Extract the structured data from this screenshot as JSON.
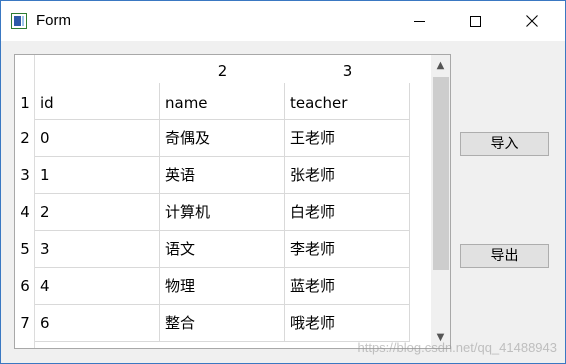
{
  "window": {
    "title": "Form",
    "controls": {
      "minimize": "minimize",
      "maximize": "maximize",
      "close": "✕"
    }
  },
  "table": {
    "column_headers": [
      "",
      "2",
      "3"
    ],
    "row_headers": [
      "1",
      "2",
      "3",
      "4",
      "5",
      "6",
      "7"
    ],
    "rows": [
      [
        "id",
        "name",
        "teacher"
      ],
      [
        "0",
        "奇偶及",
        "王老师"
      ],
      [
        "1",
        "英语",
        "张老师"
      ],
      [
        "2",
        "计算机",
        "白老师"
      ],
      [
        "3",
        "语文",
        "李老师"
      ],
      [
        "4",
        "物理",
        "蓝老师"
      ],
      [
        "6",
        "整合",
        "哦老师"
      ]
    ]
  },
  "buttons": {
    "import_label": "导入",
    "export_label": "导出"
  },
  "scrollbar": {
    "up_arrow": "▲",
    "down_arrow": "▼"
  },
  "watermark": "https://blog.csdn.net/qq_41488943"
}
